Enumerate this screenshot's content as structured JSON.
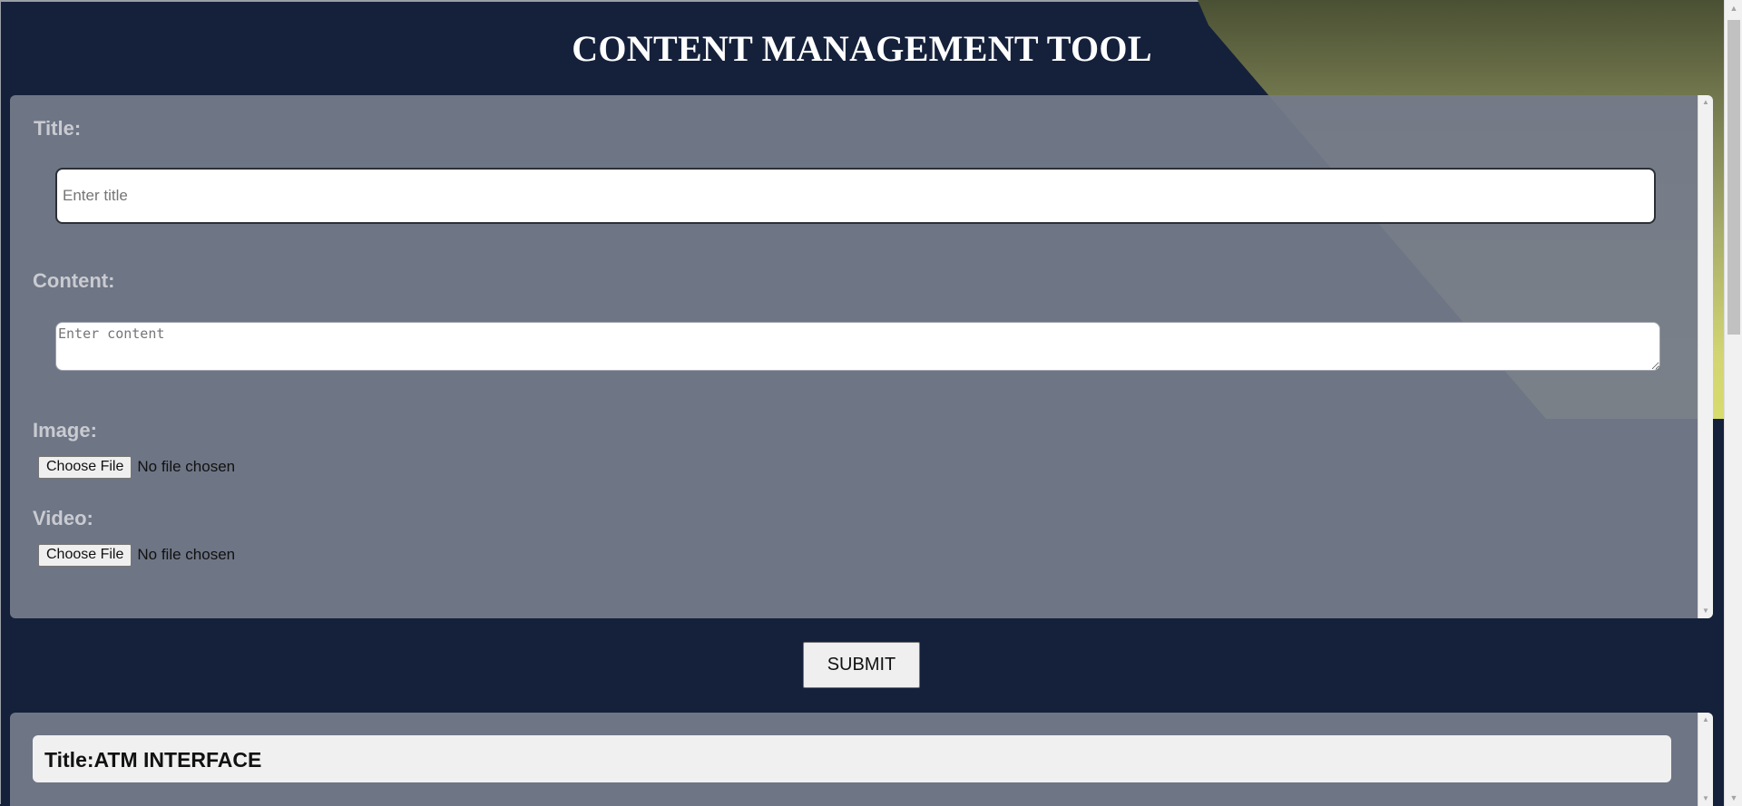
{
  "header": {
    "title": "CONTENT MANAGEMENT TOOL"
  },
  "form": {
    "title_label": "Title:",
    "title_placeholder": "Enter title",
    "title_value": "",
    "content_label": "Content:",
    "content_placeholder": "Enter content",
    "content_value": "",
    "image_label": "Image:",
    "image_button": "Choose File",
    "image_status": "No file chosen",
    "video_label": "Video:",
    "video_button": "Choose File",
    "video_status": "No file chosen",
    "submit_label": "SUBMIT"
  },
  "entries": [
    {
      "title": "Title:ATM INTERFACE"
    }
  ],
  "colors": {
    "background": "#15213b",
    "panel": "#747a8a",
    "label": "#c9cbd1",
    "accent_blob": "#d8dc6c"
  },
  "icons": {
    "scroll_up": "triangle-up",
    "scroll_down": "triangle-down"
  }
}
